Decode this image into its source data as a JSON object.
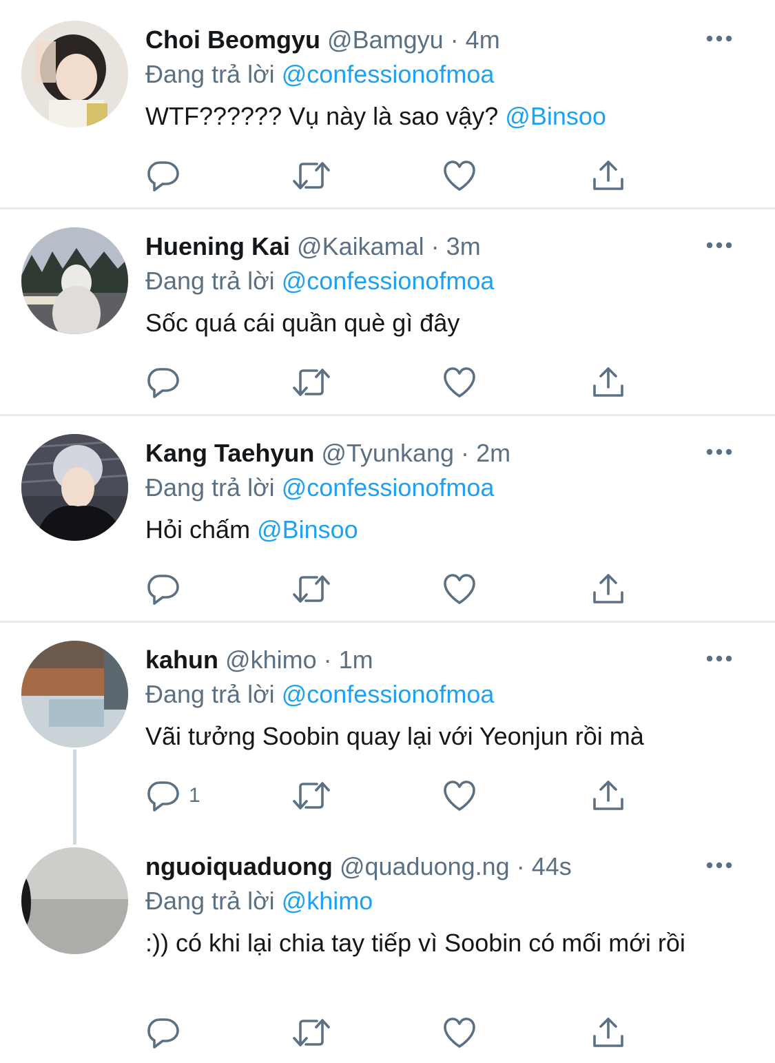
{
  "tweets": [
    {
      "name": "Choi Beomgyu",
      "handle": "@Bamgyu",
      "separator": "·",
      "time": "4m",
      "reply_prefix": "Đang trả lời",
      "reply_to": "@confessionofmoa",
      "text": "WTF?????? Vụ này là sao vậy? ",
      "mention": "@Binsoo",
      "reply_count": ""
    },
    {
      "name": "Huening Kai",
      "handle": "@Kaikamal",
      "separator": "·",
      "time": "3m",
      "reply_prefix": "Đang trả lời",
      "reply_to": "@confessionofmoa",
      "text": "Sốc quá cái quần què gì đây",
      "mention": "",
      "reply_count": ""
    },
    {
      "name": "Kang Taehyun",
      "handle": "@Tyunkang",
      "separator": "·",
      "time": "2m",
      "reply_prefix": "Đang trả lời",
      "reply_to": "@confessionofmoa",
      "text": "Hỏi chấm ",
      "mention": "@Binsoo",
      "reply_count": ""
    },
    {
      "name": "kahun",
      "handle": "@khimo",
      "separator": "·",
      "time": "1m",
      "reply_prefix": "Đang trả lời",
      "reply_to": "@confessionofmoa",
      "text": "Vãi tưởng Soobin quay lại với Yeonjun rồi mà",
      "mention": "",
      "reply_count": "1"
    },
    {
      "name": "nguoiquaduong",
      "handle": "@quaduong.ng",
      "separator": "·",
      "time": "44s",
      "reply_prefix": "Đang trả lời",
      "reply_to": "@khimo",
      "text": ":)) có khi lại chia tay tiếp vì Soobin có mối mới rồi",
      "mention": "",
      "reply_count": ""
    }
  ],
  "colors": {
    "link": "#1da1f2",
    "muted": "#5b7083",
    "text": "#14171a",
    "divider": "#e6ecf0"
  },
  "icons": [
    "reply-icon",
    "retweet-icon",
    "like-icon",
    "share-icon",
    "more-icon"
  ]
}
